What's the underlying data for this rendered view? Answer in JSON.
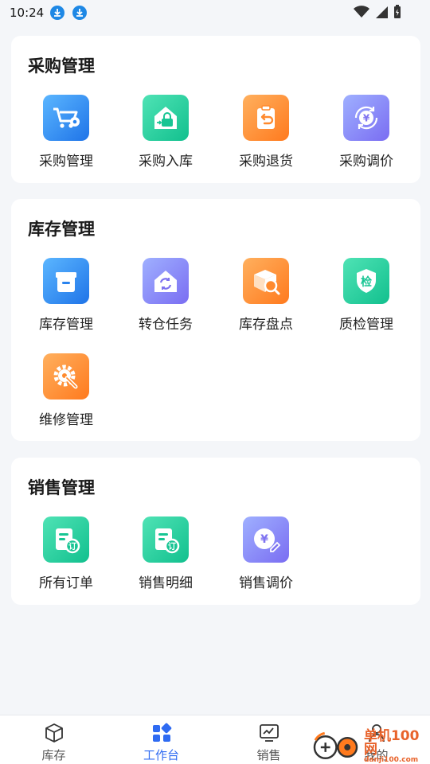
{
  "status": {
    "time": "10:24"
  },
  "sections": [
    {
      "title": "采购管理",
      "items": [
        {
          "label": "采购管理",
          "icon": "cart-gear-icon"
        },
        {
          "label": "采购入库",
          "icon": "house-basket-icon"
        },
        {
          "label": "采购退货",
          "icon": "clipboard-return-icon"
        },
        {
          "label": "采购调价",
          "icon": "yen-cycle-icon"
        }
      ]
    },
    {
      "title": "库存管理",
      "items": [
        {
          "label": "库存管理",
          "icon": "storage-box-icon"
        },
        {
          "label": "转仓任务",
          "icon": "house-transfer-icon"
        },
        {
          "label": "库存盘点",
          "icon": "box-search-icon"
        },
        {
          "label": "质检管理",
          "icon": "shield-inspect-icon",
          "glyph": "检"
        },
        {
          "label": "维修管理",
          "icon": "wrench-gear-icon"
        }
      ]
    },
    {
      "title": "销售管理",
      "items": [
        {
          "label": "所有订单",
          "icon": "order-doc-icon",
          "glyph": "订"
        },
        {
          "label": "销售明细",
          "icon": "order-doc-icon",
          "glyph": "订"
        },
        {
          "label": "销售调价",
          "icon": "yen-edit-icon",
          "glyph": "¥"
        }
      ]
    }
  ],
  "tabs": [
    {
      "label": "库存",
      "icon": "cube-icon",
      "active": false
    },
    {
      "label": "工作台",
      "icon": "grid-icon",
      "active": true
    },
    {
      "label": "销售",
      "icon": "chart-board-icon",
      "active": false
    },
    {
      "label": "我的",
      "icon": "person-icon",
      "active": false
    }
  ],
  "watermark": {
    "text": "单机100网",
    "sub": "danji100.com"
  },
  "colors": {
    "accent": "#2f6bf2",
    "blue": "#1f74e8",
    "green": "#12c08e",
    "orange": "#ff7a1e",
    "purple": "#7a6df2"
  }
}
